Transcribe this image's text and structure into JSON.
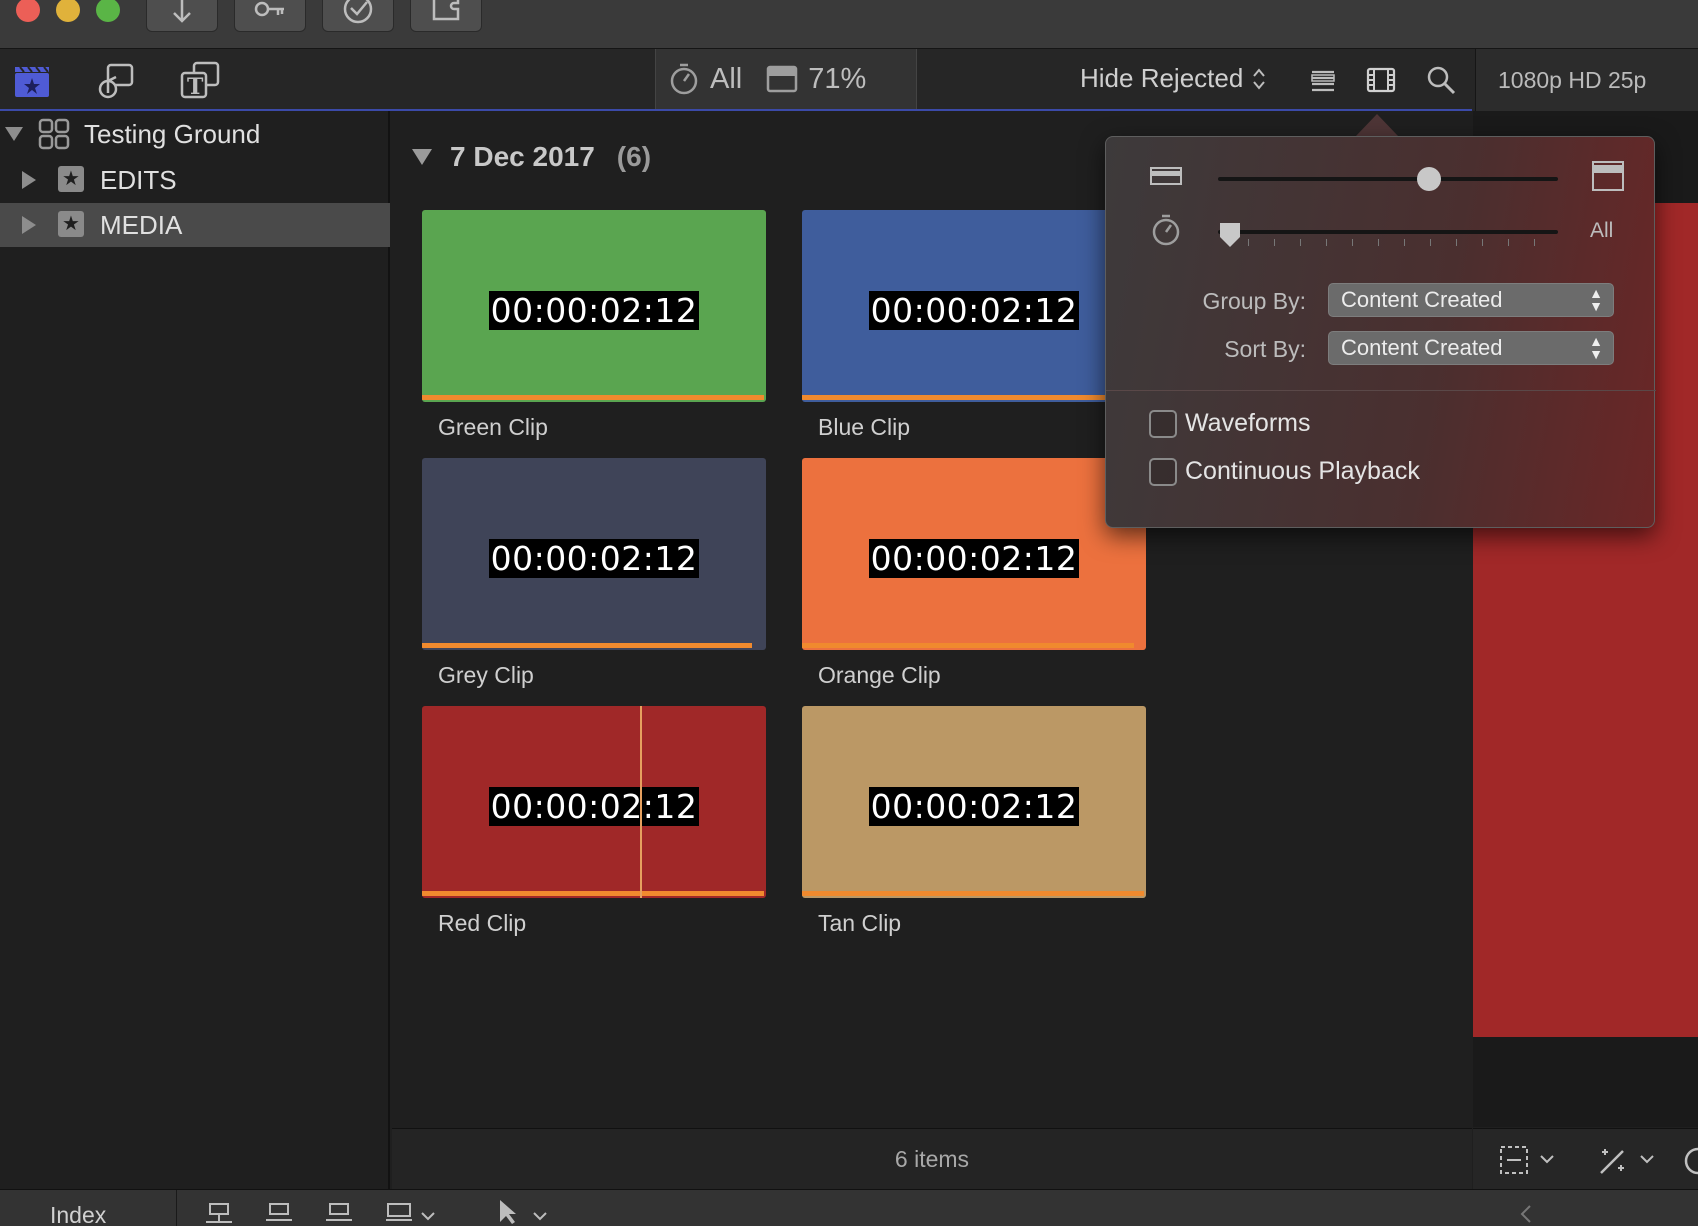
{
  "toolbar": {
    "filter_all": "All",
    "zoom_percent": "71%",
    "hide_rejected": "Hide Rejected",
    "format": "1080p HD 25p"
  },
  "sidebar": {
    "library": "Testing Ground",
    "items": [
      {
        "label": "EDITS"
      },
      {
        "label": "MEDIA"
      }
    ]
  },
  "browser": {
    "group_date": "7 Dec 2017",
    "group_count": "(6)",
    "clips": [
      {
        "name": "Green Clip",
        "timecode": "00:00:02:12",
        "color": "#5aa550"
      },
      {
        "name": "Blue Clip",
        "timecode": "00:00:02:12",
        "color": "#3f5d9c"
      },
      {
        "name": "Grey Clip",
        "timecode": "00:00:02:12",
        "color": "#3f4458"
      },
      {
        "name": "Orange Clip",
        "timecode": "00:00:02:12",
        "color": "#ec713e"
      },
      {
        "name": "Red Clip",
        "timecode": "00:00:02:12",
        "color": "#a02828"
      },
      {
        "name": "Tan Clip",
        "timecode": "00:00:02:12",
        "color": "#bb9865"
      }
    ],
    "items_count": "6 items"
  },
  "popover": {
    "duration_label": "All",
    "clip_height_level": 0.62,
    "duration_level": 0,
    "group_by_label": "Group By:",
    "group_by_value": "Content Created",
    "sort_by_label": "Sort By:",
    "sort_by_value": "Content Created",
    "waveforms_label": "Waveforms",
    "continuous_playback_label": "Continuous Playback"
  },
  "bottombar": {
    "index_label": "Index"
  },
  "colors": {
    "accent": "#3b4aa8",
    "bar": "#f08a2e",
    "viewer": "#a12828"
  }
}
